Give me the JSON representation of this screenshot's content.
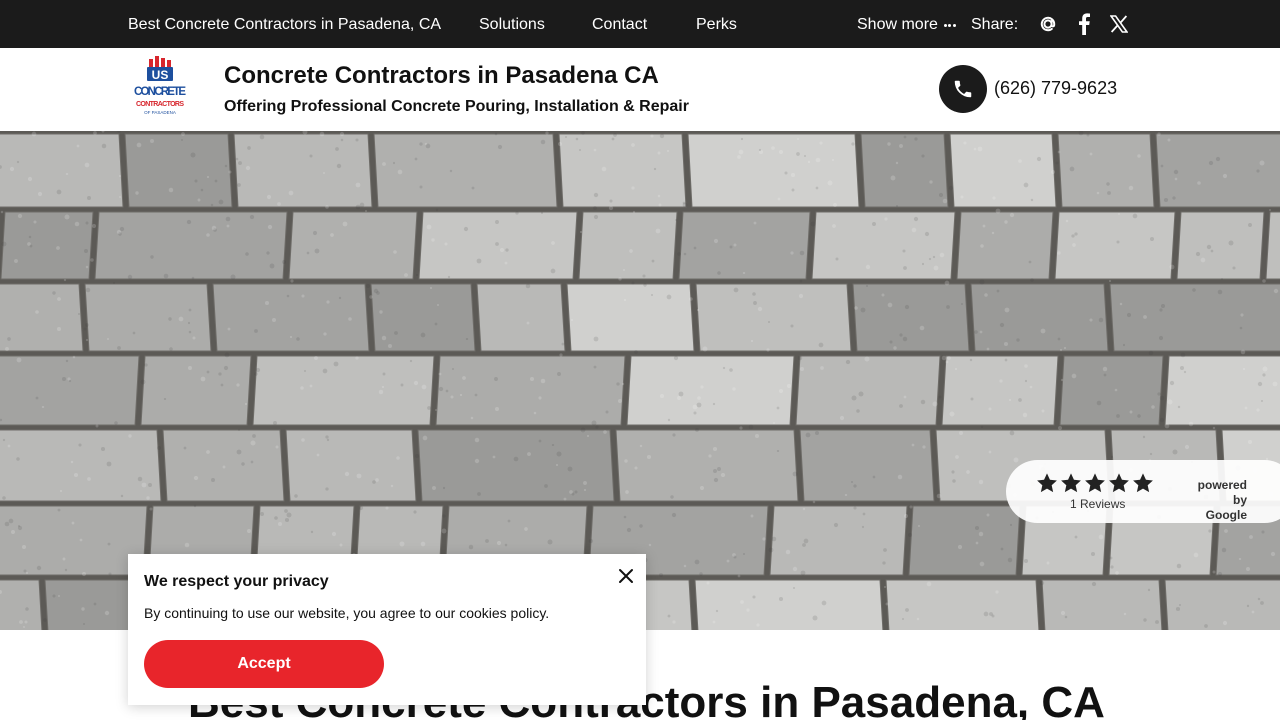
{
  "topbar": {
    "home_link": "Best Concrete Contractors in Pasadena, CA",
    "links": [
      "Solutions",
      "Contact",
      "Perks"
    ],
    "show_more": "Show more",
    "share_label": "Share:",
    "social_icons": [
      "email-at-icon",
      "facebook-icon",
      "x-twitter-icon"
    ]
  },
  "header": {
    "logo": {
      "line1": "US",
      "line2": "CONCRETE",
      "line3": "CONTRACTORS",
      "line4": "OF PASADENA"
    },
    "title": "Concrete Contractors in Pasadena CA",
    "tagline": "Offering Professional Concrete Pouring, Installation & Repair",
    "phone": "(626) 779-9623"
  },
  "reviews": {
    "rating": 5,
    "max_rating": 5,
    "count_label": "1 Reviews",
    "powered_by": "powered by",
    "provider": "Google"
  },
  "main": {
    "heading": "Best Concrete Contractors in Pasadena, CA"
  },
  "cookie": {
    "title": "We respect your privacy",
    "text": "By continuing to use our website, you agree to our cookies policy.",
    "accept_label": "Accept"
  },
  "colors": {
    "topbar_bg": "#1b1b1b",
    "accept_red": "#e8252b",
    "logo_blue": "#1d4f9e",
    "logo_red": "#d7262d"
  }
}
